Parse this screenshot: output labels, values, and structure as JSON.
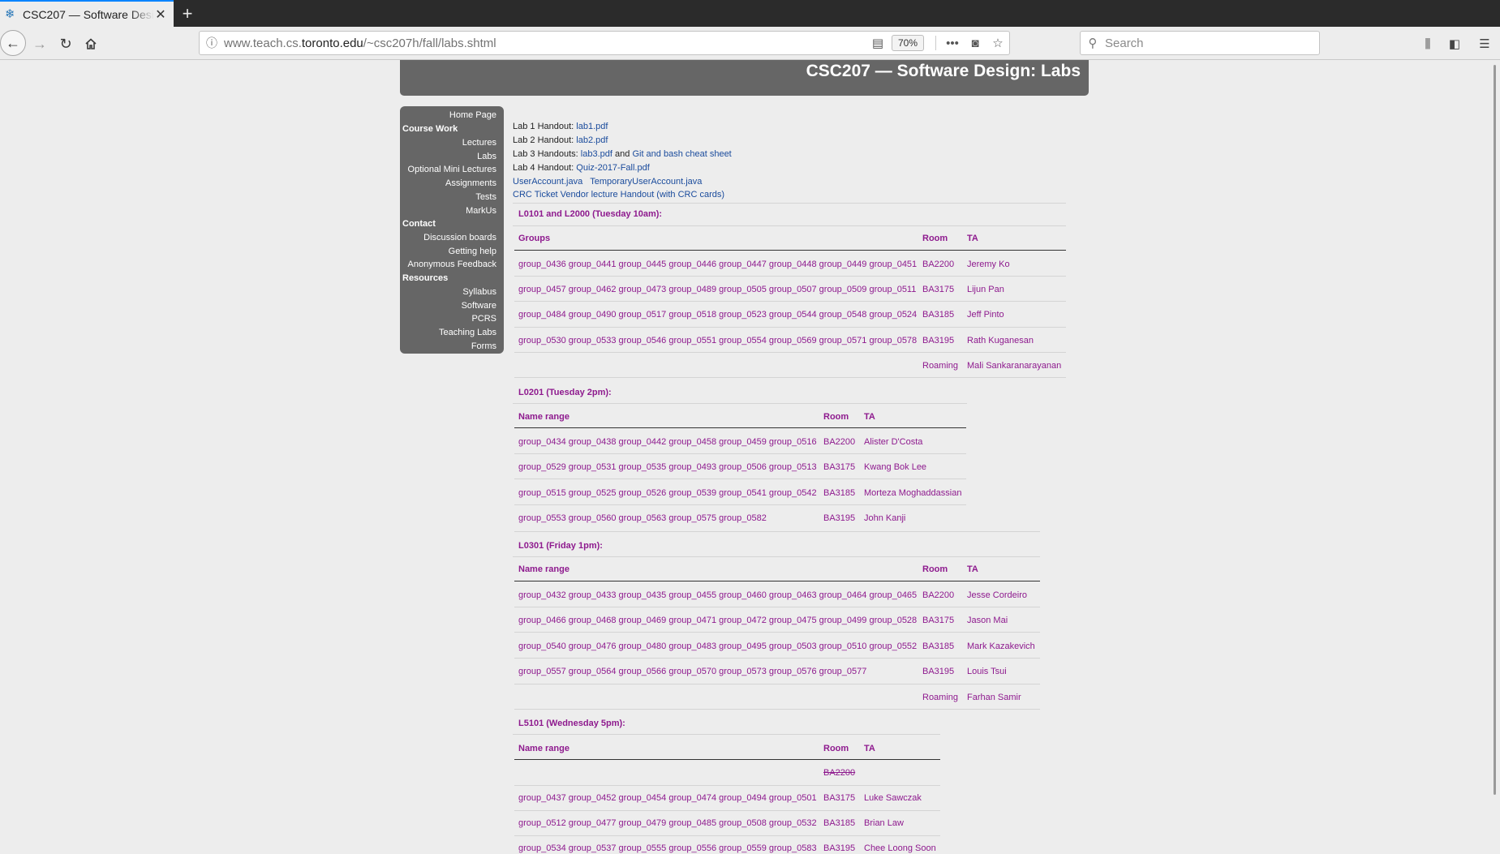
{
  "browser": {
    "tab_title": "CSC207 — Software Design: Labs",
    "new_tab_label": "+",
    "url_host_prefix": "www.teach.cs.",
    "url_host_main": "toronto.edu",
    "url_path": "/~csc207h/fall/labs.shtml",
    "zoom": "70%",
    "search_placeholder": "Search"
  },
  "page": {
    "title": "CSC207 — Software Design: Labs"
  },
  "sidebar": {
    "home": "Home Page",
    "course_work_heading": "Course Work",
    "lectures": "Lectures",
    "labs": "Labs",
    "optional_mini_lectures": "Optional Mini Lectures",
    "assignments": "Assignments",
    "tests": "Tests",
    "markus": "MarkUs",
    "contact_heading": "Contact",
    "discussion_boards": "Discussion boards",
    "getting_help": "Getting help",
    "anonymous_feedback": "Anonymous Feedback",
    "resources_heading": "Resources",
    "syllabus": "Syllabus",
    "software": "Software",
    "pcrs": "PCRS",
    "teaching_labs": "Teaching Labs",
    "forms": "Forms"
  },
  "handouts": {
    "lab1_label": "Lab 1 Handout:",
    "lab1_link": "lab1.pdf",
    "lab2_label": "Lab 2 Handout:",
    "lab2_link": "lab2.pdf",
    "lab3_label": "Lab 3 Handouts:",
    "lab3_link": "lab3.pdf",
    "lab3_and": "and",
    "lab3_link2": "Git and bash cheat sheet",
    "lab4_label": "Lab 4 Handout:",
    "lab4_link": "Quiz-2017-Fall.pdf",
    "useraccount_link": "UserAccount.java",
    "temporaryuseraccount_link": "TemporaryUserAccount.java",
    "crc_link": "CRC Ticket Vendor lecture Handout (with CRC cards)"
  },
  "sections": [
    {
      "title": "L0101 and L2000 (Tuesday 10am):",
      "headers": [
        "Groups",
        "Room",
        "TA"
      ],
      "rows": [
        [
          "group_0436 group_0441 group_0445 group_0446 group_0447 group_0448 group_0449 group_0451",
          "BA2200",
          "Jeremy Ko"
        ],
        [
          "group_0457 group_0462 group_0473 group_0489 group_0505 group_0507 group_0509 group_0511",
          "BA3175",
          "Lijun Pan"
        ],
        [
          "group_0484 group_0490 group_0517 group_0518 group_0523 group_0544 group_0548 group_0524",
          "BA3185",
          "Jeff Pinto"
        ],
        [
          "group_0530 group_0533 group_0546 group_0551 group_0554 group_0569 group_0571 group_0578",
          "BA3195",
          "Rath Kuganesan"
        ],
        [
          "",
          "Roaming",
          "Mali Sankaranarayanan"
        ]
      ]
    },
    {
      "title": "L0201 (Tuesday 2pm):",
      "headers": [
        "Name range",
        "Room",
        "TA"
      ],
      "rows": [
        [
          "group_0434 group_0438 group_0442 group_0458 group_0459 group_0516",
          "BA2200",
          "Alister D'Costa"
        ],
        [
          "group_0529 group_0531 group_0535 group_0493 group_0506 group_0513",
          "BA3175",
          "Kwang Bok Lee"
        ],
        [
          "group_0515 group_0525 group_0526 group_0539 group_0541 group_0542",
          "BA3185",
          "Morteza Moghaddassian"
        ],
        [
          "group_0553 group_0560 group_0563 group_0575 group_0582",
          "BA3195",
          "John Kanji"
        ]
      ]
    },
    {
      "title": "L0301 (Friday 1pm):",
      "headers": [
        "Name range",
        "Room",
        "TA"
      ],
      "rows": [
        [
          "group_0432 group_0433 group_0435 group_0455 group_0460 group_0463 group_0464 group_0465",
          "BA2200",
          "Jesse Cordeiro"
        ],
        [
          "group_0466 group_0468 group_0469 group_0471 group_0472 group_0475 group_0499 group_0528",
          "BA3175",
          "Jason Mai"
        ],
        [
          "group_0540 group_0476 group_0480 group_0483 group_0495 group_0503 group_0510 group_0552",
          "BA3185",
          "Mark Kazakevich"
        ],
        [
          "group_0557 group_0564 group_0566 group_0570 group_0573 group_0576 group_0577",
          "BA3195",
          "Louis Tsui"
        ],
        [
          "",
          "Roaming",
          "Farhan Samir"
        ]
      ]
    },
    {
      "title": "L5101 (Wednesday 5pm):",
      "headers": [
        "Name range",
        "Room",
        "TA"
      ],
      "rows": [
        [
          "",
          "BA2200",
          ""
        ],
        [
          "group_0437 group_0452 group_0454 group_0474 group_0494 group_0501",
          "BA3175",
          "Luke Sawczak"
        ],
        [
          "group_0512 group_0477 group_0479 group_0485 group_0508 group_0532",
          "BA3185",
          "Brian Law"
        ],
        [
          "group_0534 group_0537 group_0555 group_0556 group_0559 group_0583",
          "BA3195",
          "Chee Loong Soon"
        ]
      ]
    }
  ]
}
